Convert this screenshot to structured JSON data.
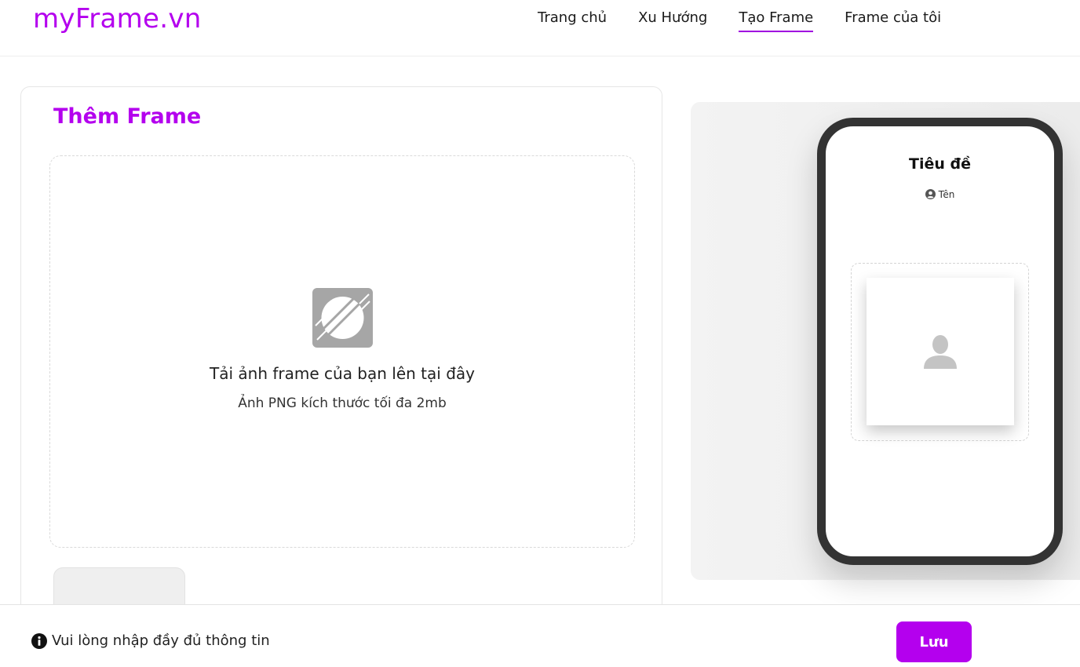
{
  "header": {
    "logo": "myFrame.vn",
    "nav": [
      {
        "label": "Trang chủ",
        "active": false
      },
      {
        "label": "Xu Hướng",
        "active": false
      },
      {
        "label": "Tạo Frame",
        "active": true
      },
      {
        "label": "Frame của tôi",
        "active": false
      }
    ]
  },
  "main": {
    "title": "Thêm Frame",
    "dropzone": {
      "icon": "upload-image-icon",
      "label": "Tải ảnh frame của bạn lên tại đây",
      "hint": "Ảnh PNG kích thước tối đa 2mb"
    }
  },
  "preview": {
    "title": "Tiêu đề",
    "author": "Tên",
    "author_icon": "user-circle-icon",
    "placeholder_icon": "avatar-placeholder-icon"
  },
  "footer": {
    "notice": "Vui lòng nhập đầy đủ thông tin",
    "notice_icon": "info-icon",
    "save_label": "Lưu"
  },
  "colors": {
    "brand": "#b400ee",
    "phone_border": "#333333"
  }
}
